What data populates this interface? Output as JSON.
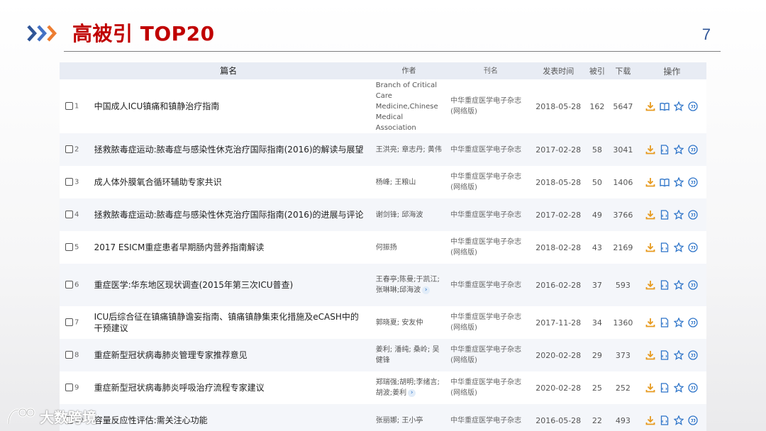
{
  "slide": {
    "title": "高被引 TOP20",
    "page_number": "7"
  },
  "table": {
    "columns": [
      "篇名",
      "作者",
      "刊名",
      "发表时间",
      "被引",
      "下载",
      "操作"
    ],
    "rows": [
      {
        "idx": "1",
        "title": "中国成人ICU镇痛和镇静治疗指南",
        "author": "Branch of Critical Care Medicine,Chinese Medical Association",
        "journal": "中华重症医学电子杂志(网络版)",
        "date": "2018-05-28",
        "cited": "162",
        "downloads": "5647",
        "view_icon": "book-icon"
      },
      {
        "idx": "2",
        "title": "拯救脓毒症运动:脓毒症与感染性休克治疗国际指南(2016)的解读与展望",
        "author": "王洪亮; 章志丹; 黄伟",
        "journal": "中华重症医学电子杂志",
        "date": "2017-02-28",
        "cited": "58",
        "downloads": "3041",
        "view_icon": "html-icon"
      },
      {
        "idx": "3",
        "title": "成人体外膜氧合循环辅助专家共识",
        "author": "杨峰; 王粮山",
        "journal": "中华重症医学电子杂志(网络版)",
        "date": "2018-05-28",
        "cited": "50",
        "downloads": "1406",
        "view_icon": "book-icon"
      },
      {
        "idx": "4",
        "title": "拯救脓毒症运动:脓毒症与感染性休克治疗国际指南(2016)的进展与评论",
        "author": "谢剑锋; 邱海波",
        "journal": "中华重症医学电子杂志",
        "date": "2017-02-28",
        "cited": "49",
        "downloads": "3766",
        "view_icon": "html-icon"
      },
      {
        "idx": "5",
        "title": "2017 ESICM重症患者早期肠内营养指南解读",
        "author": "何振扬",
        "journal": "中华重症医学电子杂志(网络版)",
        "date": "2018-02-28",
        "cited": "43",
        "downloads": "2169",
        "view_icon": "html-icon"
      },
      {
        "idx": "6",
        "title": "重症医学:华东地区现状调查(2015年第三次ICU普查)",
        "author": "王春亭;陈曼;于凯江;张琳琳;邱海波",
        "journal": "中华重症医学电子杂志",
        "date": "2016-02-28",
        "cited": "37",
        "downloads": "593",
        "view_icon": "html-icon",
        "more": "›"
      },
      {
        "idx": "7",
        "title": "ICU后综合征在镇痛镇静谵妄指南、镇痛镇静集束化措施及eCASH中的干预建议",
        "author": "郭晓夏; 安友仲",
        "journal": "中华重症医学电子杂志(网络版)",
        "date": "2017-11-28",
        "cited": "34",
        "downloads": "1360",
        "view_icon": "html-icon"
      },
      {
        "idx": "8",
        "title": "重症新型冠状病毒肺炎管理专家推荐意见",
        "author": "姜利; 潘纯; 桑岭; 吴健锋",
        "journal": "中华重症医学电子杂志(网络版)",
        "date": "2020-02-28",
        "cited": "29",
        "downloads": "373",
        "view_icon": "html-icon"
      },
      {
        "idx": "9",
        "title": "重症新型冠状病毒肺炎呼吸治疗流程专家建议",
        "author": "郑瑞强;胡明;李绪言;胡波;姜利",
        "journal": "中华重症医学电子杂志(网络版)",
        "date": "2020-02-28",
        "cited": "25",
        "downloads": "252",
        "view_icon": "html-icon",
        "more": "›"
      },
      {
        "idx": "10",
        "title": "容量反应性评估:需关注心功能",
        "author": "张丽娜; 王小亭",
        "journal": "中华重症医学电子杂志",
        "date": "2016-05-28",
        "cited": "22",
        "downloads": "493",
        "view_icon": "html-icon"
      }
    ]
  },
  "watermark": {
    "text": "大数跨境"
  },
  "colors": {
    "title": "#c00000",
    "page_number": "#2f5597",
    "header_bg": "#e8ecf4",
    "icon_blue": "#2f75c9",
    "icon_orange": "#e79a1f"
  }
}
